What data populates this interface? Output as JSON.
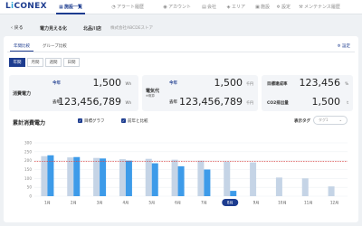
{
  "brand": {
    "logo_pre": "L",
    "logo_i": "i",
    "logo_post": "CONEX"
  },
  "nav": [
    {
      "label": "施設一覧",
      "icon": "building-icon",
      "glyph": "▦"
    },
    {
      "label": "アラート履歴",
      "icon": "bell-icon",
      "glyph": "◔"
    },
    {
      "label": "アカウント",
      "icon": "person-icon",
      "glyph": "◉"
    },
    {
      "label": "会社",
      "icon": "company-icon",
      "glyph": "▤"
    },
    {
      "label": "エリア",
      "icon": "pin-icon",
      "glyph": "◈"
    },
    {
      "label": "施設",
      "icon": "facility-icon",
      "glyph": "▣"
    },
    {
      "label": "設定",
      "icon": "gear-icon",
      "glyph": "✲"
    },
    {
      "label": "メンテナンス履歴",
      "icon": "wrench-icon",
      "glyph": "⚒"
    }
  ],
  "breadcrumb": {
    "back": "戻る",
    "page": "電力見える化",
    "store": "北品川店",
    "company": "株式会社ABCDEストア"
  },
  "tabs": [
    "年間比較",
    "グループ比較"
  ],
  "settings_label": "設定",
  "periods": [
    "年間",
    "月間",
    "週間",
    "日間"
  ],
  "cards": {
    "power": {
      "label": "消費電力",
      "this_year_label": "今年",
      "last_year_label": "去年",
      "this_year": "1,500",
      "last_year": "123,456,789",
      "unit": "Wh"
    },
    "cost": {
      "label": "電気代",
      "sub": "※概算",
      "this_year_label": "今年",
      "last_year_label": "去年",
      "this_year": "1,500",
      "last_year": "123,456,789",
      "unit": "千円"
    },
    "target": {
      "rate_label": "目標達成率",
      "rate": "123,456",
      "rate_unit": "%",
      "co2_label": "CO2排出量",
      "co2": "1,500",
      "co2_unit": "t"
    }
  },
  "section": {
    "title": "累計消費電力",
    "target_graph": "目標グラフ",
    "compare": "前年と比較",
    "tag_label": "表示タグ",
    "tag_placeholder": "タグ1"
  },
  "colors": {
    "accent": "#1d3c8f",
    "this_year_bar": "#3d9be9",
    "last_year_bar": "#c5d4e6",
    "target_line": "#d84848"
  },
  "chart_data": {
    "type": "bar",
    "categories": [
      "1月",
      "2月",
      "3月",
      "4月",
      "5月",
      "6月",
      "7月",
      "8月",
      "9月",
      "10月",
      "11月",
      "12月"
    ],
    "selected_category": "8月",
    "ylim": [
      0,
      300
    ],
    "yticks": [
      0,
      50,
      100,
      150,
      200,
      250,
      300
    ],
    "target_line": 195,
    "series": [
      {
        "name": "前年",
        "values": [
          225,
          218,
          215,
          208,
          210,
          205,
          200,
          195,
          190,
          105,
          100,
          55
        ]
      },
      {
        "name": "今年",
        "values": [
          230,
          220,
          212,
          200,
          185,
          168,
          150,
          30,
          null,
          null,
          null,
          null
        ]
      }
    ]
  }
}
